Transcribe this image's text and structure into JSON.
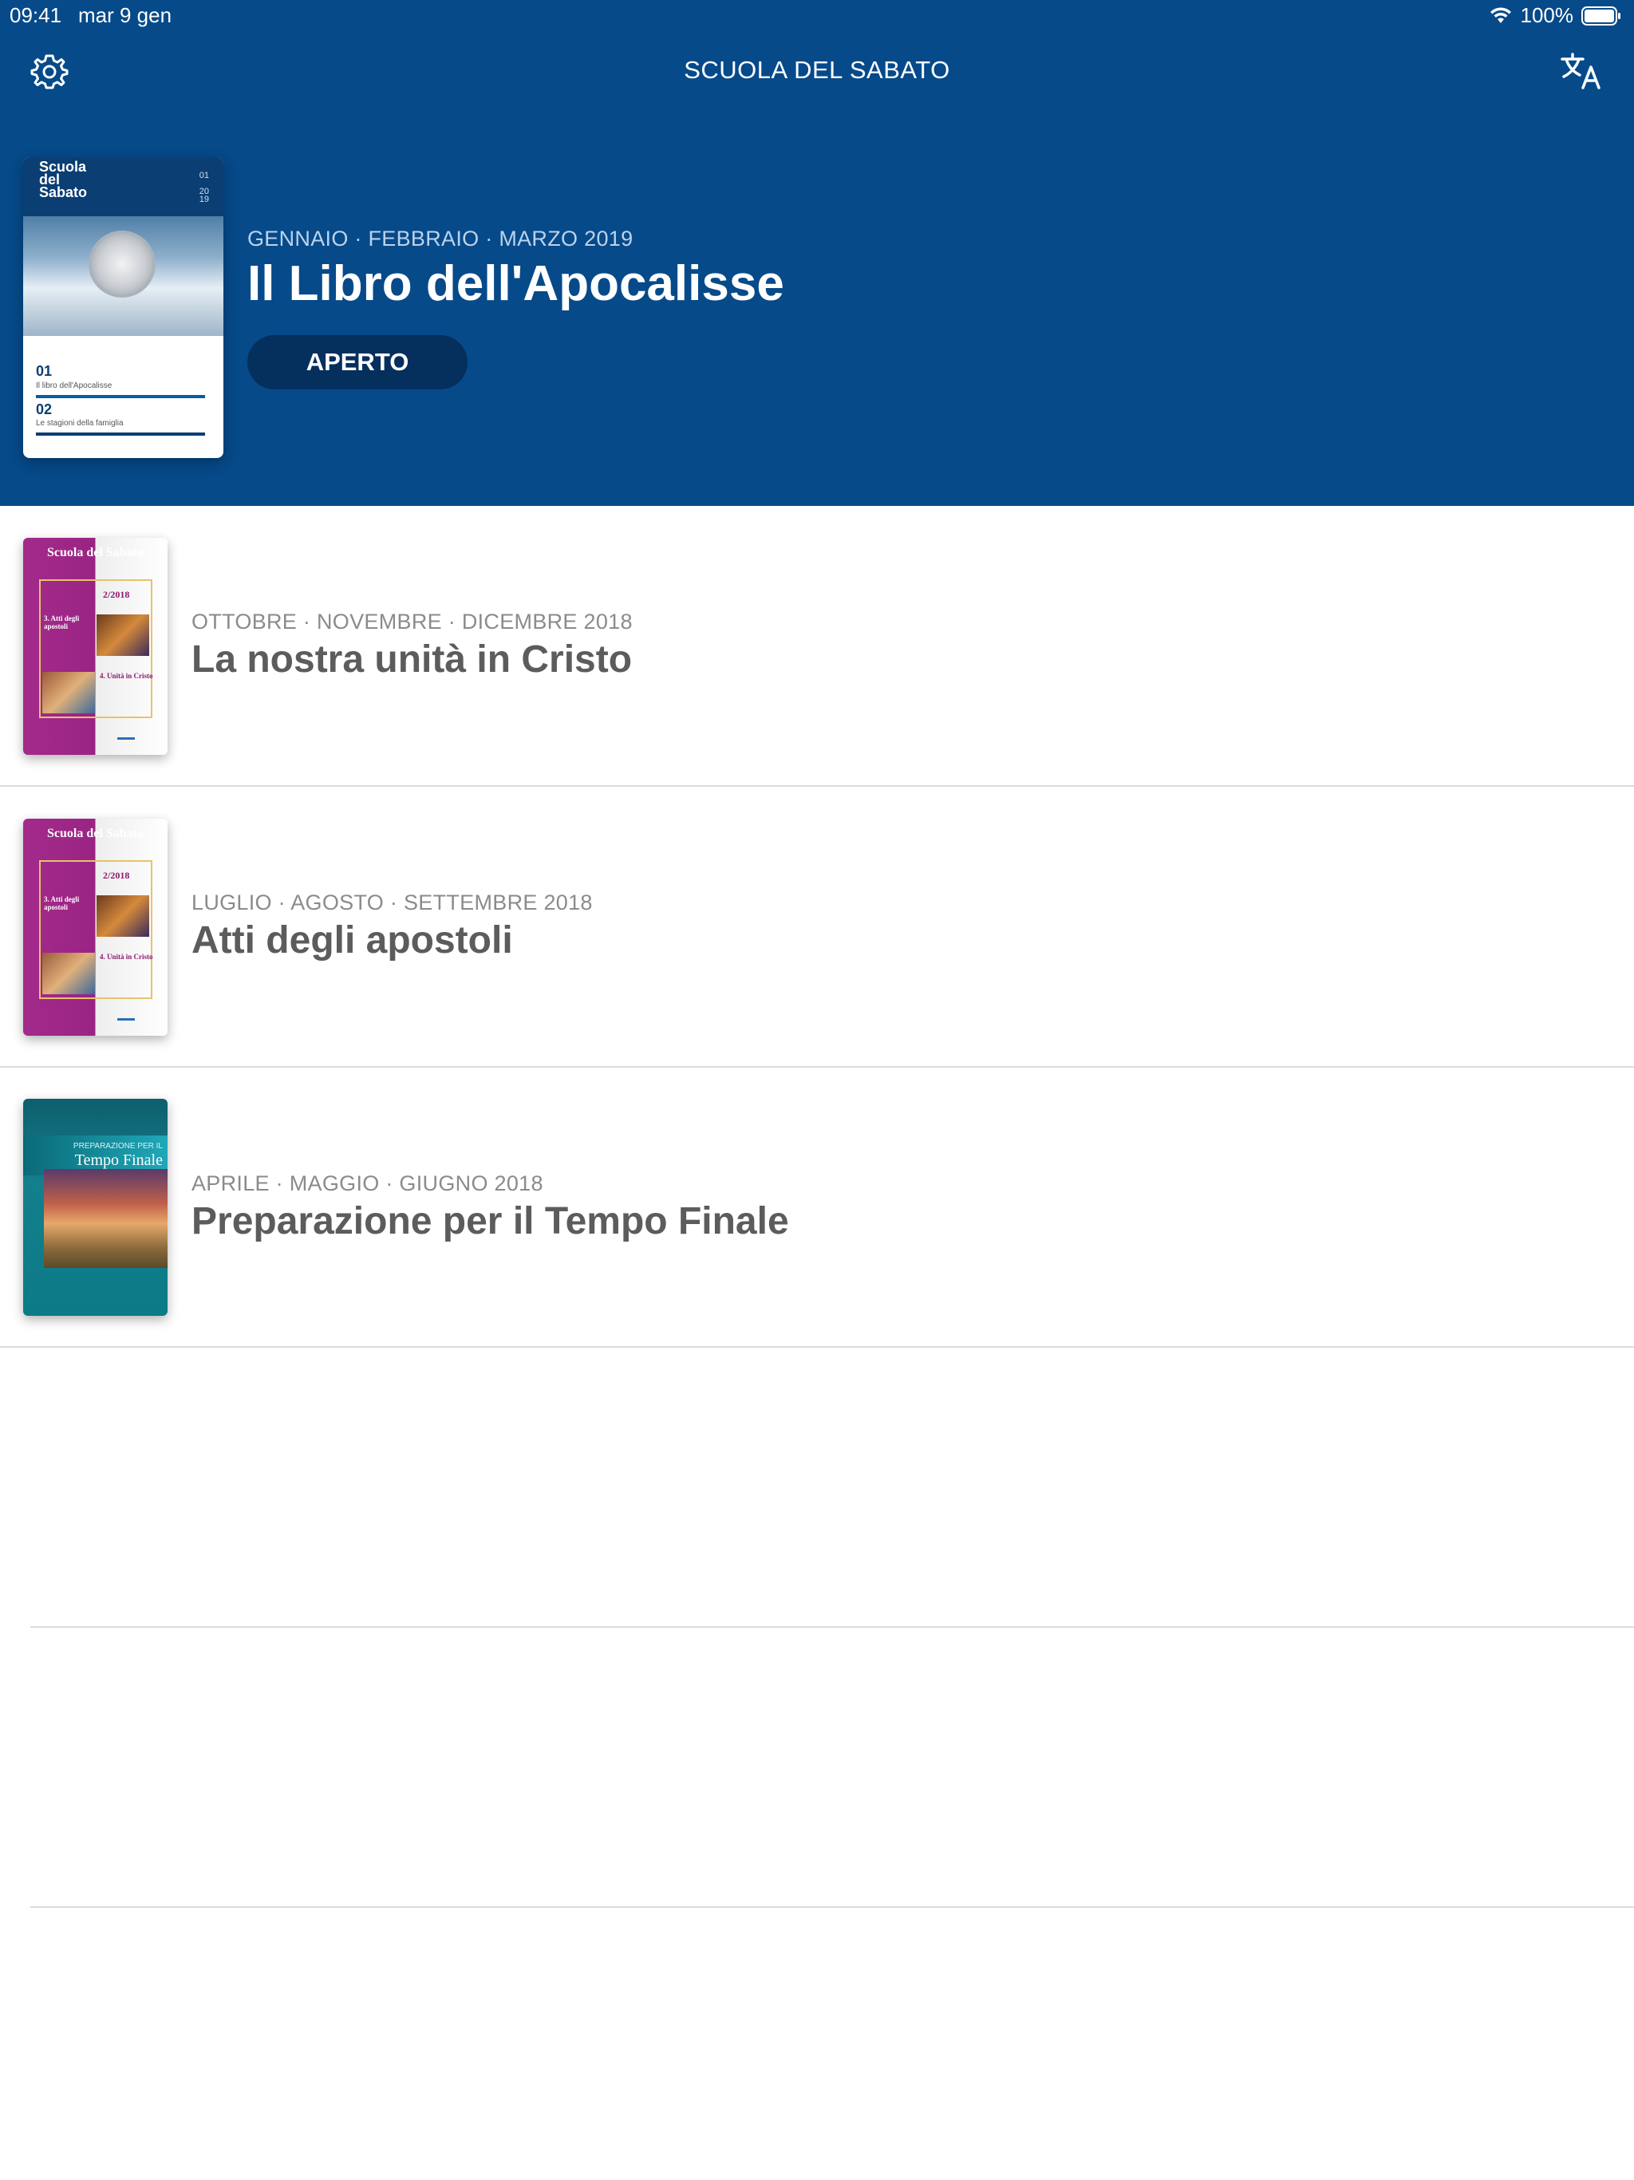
{
  "status_bar": {
    "time": "09:41",
    "date": "mar 9 gen",
    "battery": "100%"
  },
  "header": {
    "title": "SCUOLA DEL SABATO",
    "settings_icon": "gear-icon",
    "translate_icon": "translate-icon",
    "background_color": "#064a8a"
  },
  "featured": {
    "dates": "GENNAIO · FEBBRAIO · MARZO 2019",
    "title": "Il Libro dell'Apocalisse",
    "open_label": "APERTO",
    "cover": {
      "title_line1": "Scuola",
      "title_line2": "del",
      "title_line3": "Sabato",
      "num": "01",
      "year1": "20",
      "year2": "19",
      "item1_num": "01",
      "item1_text": "Il libro dell'Apocalisse",
      "item2_num": "02",
      "item2_text": "Le stagioni della famiglia"
    }
  },
  "quarterlies": [
    {
      "dates": "OTTOBRE · NOVEMBRE · DICEMBRE 2018",
      "title": "La nostra unità in Cristo",
      "cover": {
        "head": "Scuola del Sabato",
        "year": "2/2018",
        "t1": "3. Atti degli apostoli",
        "t2": "4. Unità in Cristo"
      }
    },
    {
      "dates": "LUGLIO · AGOSTO · SETTEMBRE 2018",
      "title": "Atti degli apostoli",
      "cover": {
        "head": "Scuola del Sabato",
        "year": "2/2018",
        "t1": "3. Atti degli apostoli",
        "t2": "4. Unità in Cristo"
      }
    },
    {
      "dates": "APRILE · MAGGIO · GIUGNO 2018",
      "title": "Preparazione per il Tempo Finale",
      "cover": {
        "sub": "PREPARAZIONE PER IL",
        "title": "Tempo Finale"
      }
    }
  ]
}
